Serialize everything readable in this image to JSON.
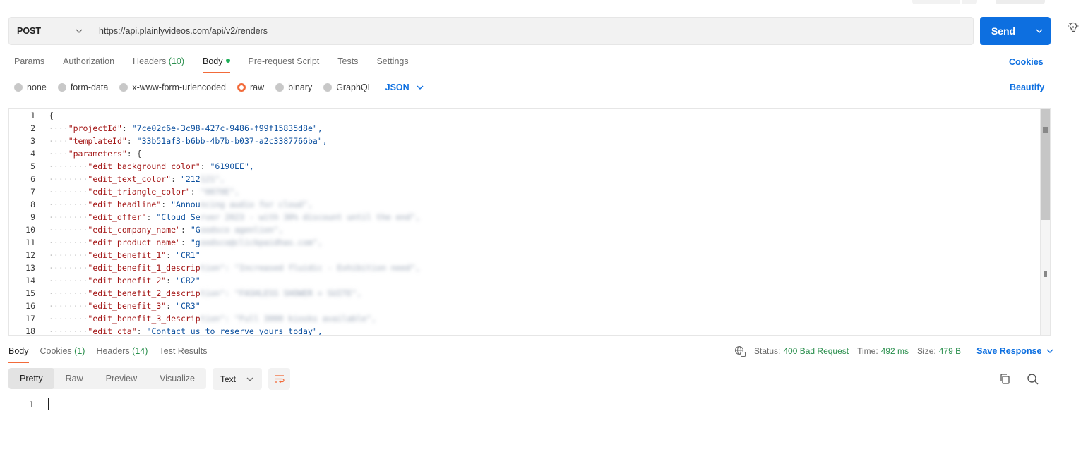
{
  "request": {
    "method": "POST",
    "url": "https://api.plainlyvideos.com/api/v2/renders",
    "send_label": "Send"
  },
  "request_tabs": [
    {
      "label": "Params"
    },
    {
      "label": "Authorization"
    },
    {
      "label": "Headers",
      "count": "(10)"
    },
    {
      "label": "Body"
    },
    {
      "label": "Pre-request Script"
    },
    {
      "label": "Tests"
    },
    {
      "label": "Settings"
    }
  ],
  "cookies_link": "Cookies",
  "body_types": [
    {
      "label": "none",
      "selected": false
    },
    {
      "label": "form-data",
      "selected": false
    },
    {
      "label": "x-www-form-urlencoded",
      "selected": false
    },
    {
      "label": "raw",
      "selected": true
    },
    {
      "label": "binary",
      "selected": false
    },
    {
      "label": "GraphQL",
      "selected": false
    }
  ],
  "body_format": "JSON",
  "beautify_link": "Beautify",
  "code_lines": [
    {
      "indent": "",
      "key": "",
      "punct": "{",
      "value": "",
      "blurred": ""
    },
    {
      "indent": "····",
      "key": "\"projectId\"",
      "punct": ": ",
      "value": "\"7ce02c6e-3c98-427c-9486-f99f15835d8e\",",
      "blurred": ""
    },
    {
      "indent": "····",
      "key": "\"templateId\"",
      "punct": ": ",
      "value": "\"33b51af3-b6bb-4b7b-b037-a2c3387766ba\",",
      "blurred": ""
    },
    {
      "indent": "····",
      "key": "\"parameters\"",
      "punct": ": {",
      "value": "",
      "blurred": ""
    },
    {
      "indent": "········",
      "key": "\"edit_background_color\"",
      "punct": ": ",
      "value": "\"6190EE\",",
      "blurred": ""
    },
    {
      "indent": "········",
      "key": "\"edit_text_color\"",
      "punct": ": ",
      "value": "\"212",
      "blurred": "121\","
    },
    {
      "indent": "········",
      "key": "\"edit_triangle_color\"",
      "punct": ": ",
      "value": "",
      "blurred": "\"0070E\","
    },
    {
      "indent": "········",
      "key": "\"edit_headline\"",
      "punct": ": ",
      "value": "\"Annou",
      "blurred": "ncing audio for cloud\","
    },
    {
      "indent": "········",
      "key": "\"edit_offer\"",
      "punct": ": ",
      "value": "\"Cloud Se",
      "blurred": "rver 2023 - with 30% discount until the end\","
    },
    {
      "indent": "········",
      "key": "\"edit_company_name\"",
      "punct": ": ",
      "value": "\"G",
      "blurred": "oodsco agenlion\","
    },
    {
      "indent": "········",
      "key": "\"edit_product_name\"",
      "punct": ": ",
      "value": "\"g",
      "blurred": "oodsco@clickpaidhas.com\","
    },
    {
      "indent": "········",
      "key": "\"edit_benefit_1\"",
      "punct": ": ",
      "value": "\"CR1\"",
      "blurred": ""
    },
    {
      "indent": "········",
      "key": "\"edit_benefit_1_descrip",
      "punct": "",
      "value": "",
      "blurred": "tion\": \"Increased fluidic - Exhibition need\","
    },
    {
      "indent": "········",
      "key": "\"edit_benefit_2\"",
      "punct": ": ",
      "value": "\"CR2\"",
      "blurred": ""
    },
    {
      "indent": "········",
      "key": "\"edit_benefit_2_descrip",
      "punct": "",
      "value": "",
      "blurred": "tion\": \"FASHLESS SHOWER + SUITE\","
    },
    {
      "indent": "········",
      "key": "\"edit_benefit_3\"",
      "punct": ": ",
      "value": "\"CR3\"",
      "blurred": ""
    },
    {
      "indent": "········",
      "key": "\"edit_benefit_3_descrip",
      "punct": "",
      "value": "",
      "blurred": "tion\": \"Full 3000 kiosks available\","
    },
    {
      "indent": "········",
      "key": "\"edit_cta\"",
      "punct": ": ",
      "value": "\"Contact us to reserve yours today\",",
      "blurred": ""
    }
  ],
  "response_tabs": [
    {
      "label": "Body"
    },
    {
      "label": "Cookies",
      "count": "(1)"
    },
    {
      "label": "Headers",
      "count": "(14)"
    },
    {
      "label": "Test Results"
    }
  ],
  "status": {
    "status_label": "Status:",
    "status_value": "400 Bad Request",
    "time_label": "Time:",
    "time_value": "492 ms",
    "size_label": "Size:",
    "size_value": "479 B",
    "save_response": "Save Response"
  },
  "view_modes": [
    {
      "label": "Pretty",
      "active": true
    },
    {
      "label": "Raw",
      "active": false
    },
    {
      "label": "Preview",
      "active": false
    },
    {
      "label": "Visualize",
      "active": false
    }
  ],
  "response_format": "Text",
  "response_line_number": "1",
  "colors": {
    "accent": "#f26b3a",
    "primary": "#0d6fe0",
    "success": "#2a8f4d"
  }
}
